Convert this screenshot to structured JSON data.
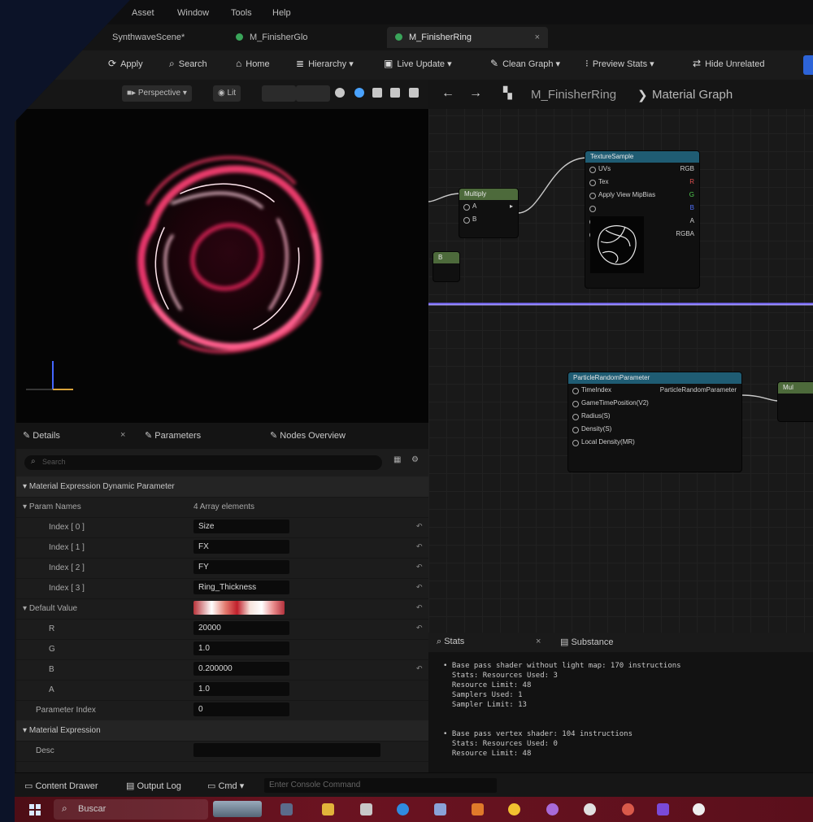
{
  "menu": [
    "Asset",
    "Window",
    "Tools",
    "Help"
  ],
  "tabs": [
    {
      "label": "SynthwaveScene*",
      "active": false
    },
    {
      "label": "M_FinisherGlo",
      "active": false
    },
    {
      "label": "M_FinisherRing",
      "active": true
    }
  ],
  "tab_close": "×",
  "toolbar": {
    "apply": "Apply",
    "search": "Search",
    "home": "Home",
    "hierarchy": "Hierarchy",
    "live_update": "Live Update",
    "clean_graph": "Clean Graph",
    "preview_stats": "Preview Stats",
    "hide_unrelated": "Hide Unrelated"
  },
  "viewport_toolbar": {
    "perspective": "Perspective",
    "lit": "Lit"
  },
  "graph": {
    "breadcrumb_asset": "M_FinisherRing",
    "breadcrumb_sep": "❯",
    "breadcrumb_graph": "Material Graph",
    "multiply_node": {
      "title": "Multiply",
      "pins": [
        "A",
        "B"
      ]
    },
    "small_node": {
      "title": "B"
    },
    "texture_node": {
      "title": "TextureSample",
      "pins": [
        {
          "label": "UVs",
          "value": "RGB"
        },
        {
          "label": "Tex",
          "value": "R"
        },
        {
          "label": "Apply View MipBias",
          "value": "G"
        },
        {
          "label": "",
          "value": "B"
        },
        {
          "label": "",
          "value": "A"
        },
        {
          "label": "",
          "value": "RGBA"
        }
      ]
    },
    "particle_node": {
      "title": "ParticleRandomParameter",
      "output": "ParticleRandomParameter",
      "pins": [
        "TimeIndex",
        "GameTimePosition(V2)",
        "Radius(S)",
        "Density(S)",
        "Local Density(MR)"
      ]
    },
    "right_node": {
      "title": "Mul"
    }
  },
  "details": {
    "tabs": [
      "Details",
      "Parameters",
      "Nodes Overview"
    ],
    "search_placeholder": "Search",
    "category": "Material Expression Dynamic Parameter",
    "param_names_label": "Param Names",
    "param_names_value": "4 Array elements",
    "indices": [
      {
        "label": "Index [ 0 ]",
        "value": "Size"
      },
      {
        "label": "Index [ 1 ]",
        "value": "FX"
      },
      {
        "label": "Index [ 2 ]",
        "value": "FY"
      },
      {
        "label": "Index [ 3 ]",
        "value": "Ring_Thickness"
      }
    ],
    "default_value_label": "Default Value",
    "rgba": [
      {
        "label": "R",
        "value": "20000"
      },
      {
        "label": "G",
        "value": "1.0"
      },
      {
        "label": "B",
        "value": "0.200000"
      },
      {
        "label": "A",
        "value": "1.0"
      }
    ],
    "parameter_index_label": "Parameter Index",
    "parameter_index_value": "0",
    "section_material_expression": "Material Expression",
    "desc_label": "Desc",
    "reset_icon": "↶"
  },
  "stats": {
    "tab1": "Stats",
    "tab2": "Substance",
    "lines": [
      "• Base pass shader without light map: 170 instructions",
      "  Stats: Resources Used: 3",
      "  Resource Limit: 48",
      "  Samplers Used: 1",
      "  Sampler Limit: 13",
      "",
      "• Base pass vertex shader: 104 instructions",
      "  Stats: Resources Used: 0",
      "  Resource Limit: 48"
    ]
  },
  "bottombar": {
    "content_drawer": "Content Drawer",
    "output_log": "Output Log",
    "cmd": "Cmd",
    "cmd_placeholder": "Enter Console Command"
  },
  "taskbar": {
    "search": "Buscar"
  },
  "colors": {
    "accent_blue": "#2d64d8",
    "tab_dot": "#3aa55a",
    "ring_pink": "#ff4f8f",
    "wire_purple": "#7b6cff",
    "taskbar": "#5a0f1b"
  }
}
